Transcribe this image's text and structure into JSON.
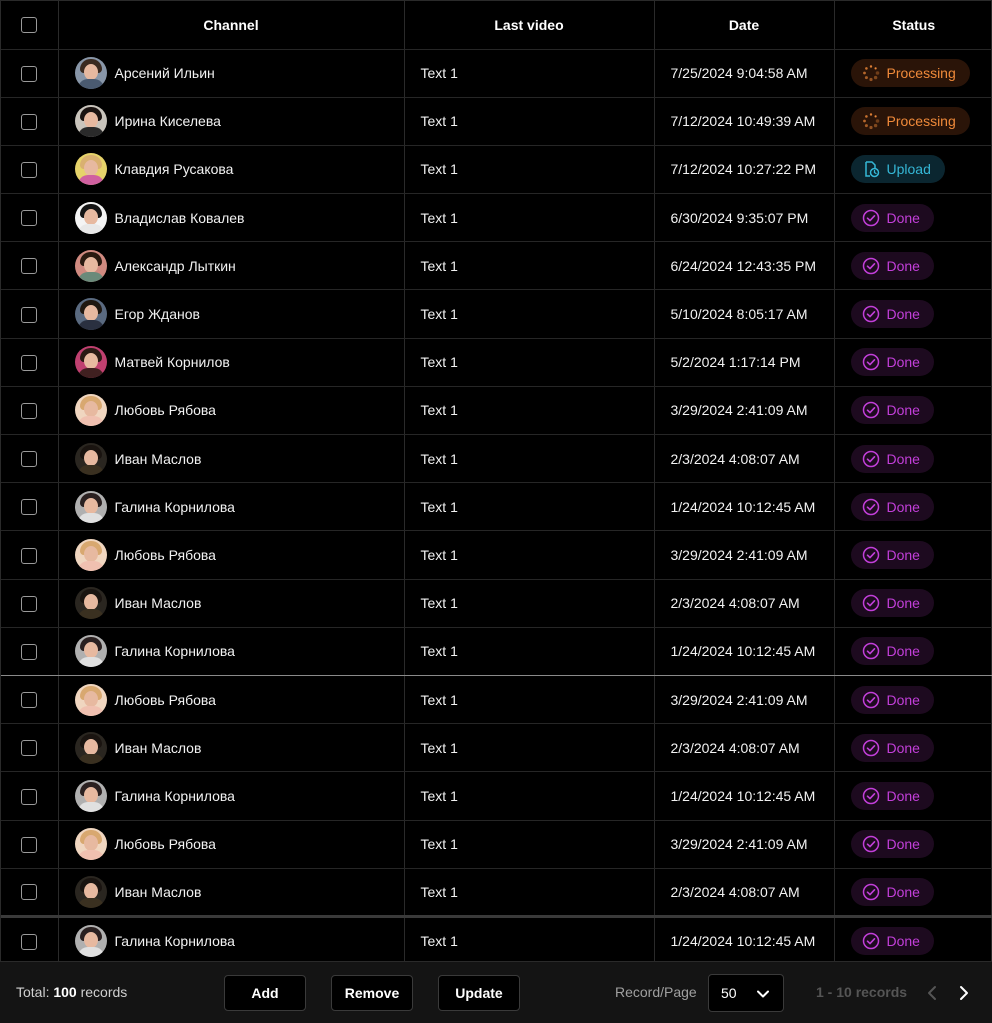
{
  "table": {
    "headers": {
      "channel": "Channel",
      "last_video": "Last video",
      "date": "Date",
      "status": "Status"
    },
    "rows": [
      {
        "name": "Арсений Ильин",
        "video": "Text 1",
        "date": "7/25/2024 9:04:58 AM",
        "status": "Processing",
        "avatar": {
          "hair": "#3a2a20",
          "body": "#4a5a70",
          "bg": "#8896a8"
        }
      },
      {
        "name": "Ирина Киселева",
        "video": "Text 1",
        "date": "7/12/2024 10:49:39 AM",
        "status": "Processing",
        "avatar": {
          "hair": "#1a1210",
          "body": "#2a2a2a",
          "bg": "#c9c4bc"
        }
      },
      {
        "name": "Клавдия Русакова",
        "video": "Text 1",
        "date": "7/12/2024 10:27:22 PM",
        "status": "Upload",
        "avatar": {
          "hair": "#d9b070",
          "body": "#d060a0",
          "bg": "#e6d36a"
        }
      },
      {
        "name": "Владислав Ковалев",
        "video": "Text 1",
        "date": "6/30/2024 9:35:07 PM",
        "status": "Done",
        "avatar": {
          "hair": "#151515",
          "body": "#e8e8e8",
          "bg": "#f4f4f4"
        }
      },
      {
        "name": "Александр Лыткин",
        "video": "Text 1",
        "date": "6/24/2024 12:43:35 PM",
        "status": "Done",
        "avatar": {
          "hair": "#2a1a10",
          "body": "#6a8a7a",
          "bg": "#d08a80"
        }
      },
      {
        "name": "Егор Жданов",
        "video": "Text 1",
        "date": "5/10/2024 8:05:17 AM",
        "status": "Done",
        "avatar": {
          "hair": "#201810",
          "body": "#2a3040",
          "bg": "#5a6a80"
        }
      },
      {
        "name": "Матвей Корнилов",
        "video": "Text 1",
        "date": "5/2/2024 1:17:14 PM",
        "status": "Done",
        "avatar": {
          "hair": "#2a1a14",
          "body": "#402020",
          "bg": "#c04070"
        }
      },
      {
        "name": "Любовь Рябова",
        "video": "Text 1",
        "date": "3/29/2024 2:41:09 AM",
        "status": "Done",
        "avatar": {
          "hair": "#d8a870",
          "body": "#f0c0b0",
          "bg": "#f0d6c0"
        }
      },
      {
        "name": "Иван Маслов",
        "video": "Text 1",
        "date": "2/3/2024 4:08:07 AM",
        "status": "Done",
        "avatar": {
          "hair": "#1a1410",
          "body": "#3a3020",
          "bg": "#2a2620"
        }
      },
      {
        "name": "Галина Корнилова",
        "video": "Text 1",
        "date": "1/24/2024 10:12:45 AM",
        "status": "Done",
        "avatar": {
          "hair": "#2a2020",
          "body": "#e0e0e0",
          "bg": "#b0b0b0"
        }
      },
      {
        "name": "Любовь Рябова",
        "video": "Text 1",
        "date": "3/29/2024 2:41:09 AM",
        "status": "Done",
        "avatar": {
          "hair": "#d8a870",
          "body": "#f0c0b0",
          "bg": "#f0d6c0"
        }
      },
      {
        "name": "Иван Маслов",
        "video": "Text 1",
        "date": "2/3/2024 4:08:07 AM",
        "status": "Done",
        "avatar": {
          "hair": "#1a1410",
          "body": "#3a3020",
          "bg": "#2a2620"
        }
      },
      {
        "name": "Галина Корнилова",
        "video": "Text 1",
        "date": "1/24/2024 10:12:45 AM",
        "status": "Done",
        "avatar": {
          "hair": "#2a2020",
          "body": "#e0e0e0",
          "bg": "#b0b0b0"
        }
      },
      {
        "name": "Любовь Рябова",
        "video": "Text 1",
        "date": "3/29/2024 2:41:09 AM",
        "status": "Done",
        "avatar": {
          "hair": "#d8a870",
          "body": "#f0c0b0",
          "bg": "#f0d6c0"
        }
      },
      {
        "name": "Иван Маслов",
        "video": "Text 1",
        "date": "2/3/2024 4:08:07 AM",
        "status": "Done",
        "avatar": {
          "hair": "#1a1410",
          "body": "#3a3020",
          "bg": "#2a2620"
        }
      },
      {
        "name": "Галина Корнилова",
        "video": "Text 1",
        "date": "1/24/2024 10:12:45 AM",
        "status": "Done",
        "avatar": {
          "hair": "#2a2020",
          "body": "#e0e0e0",
          "bg": "#b0b0b0"
        }
      },
      {
        "name": "Любовь Рябова",
        "video": "Text 1",
        "date": "3/29/2024 2:41:09 AM",
        "status": "Done",
        "avatar": {
          "hair": "#d8a870",
          "body": "#f0c0b0",
          "bg": "#f0d6c0"
        }
      },
      {
        "name": "Иван Маслов",
        "video": "Text 1",
        "date": "2/3/2024 4:08:07 AM",
        "status": "Done",
        "avatar": {
          "hair": "#1a1410",
          "body": "#3a3020",
          "bg": "#2a2620"
        }
      },
      {
        "name": "Галина Корнилова",
        "video": "Text 1",
        "date": "1/24/2024 10:12:45 AM",
        "status": "Done",
        "avatar": {
          "hair": "#2a2020",
          "body": "#e0e0e0",
          "bg": "#b0b0b0"
        }
      }
    ]
  },
  "status_colors": {
    "Processing": "#f08a3a",
    "Upload": "#35b7d6",
    "Done": "#c23fd9"
  },
  "status_icons": {
    "Processing": "spinner-icon",
    "Upload": "upload-clock-icon",
    "Done": "check-circle-icon"
  },
  "footer": {
    "total_prefix": "Total:",
    "total_count": "100",
    "total_suffix": "records",
    "add_label": "Add",
    "remove_label": "Remove",
    "update_label": "Update",
    "record_page_label": "Record/Page",
    "page_size": "50",
    "range_text": "1 - 10 records"
  }
}
